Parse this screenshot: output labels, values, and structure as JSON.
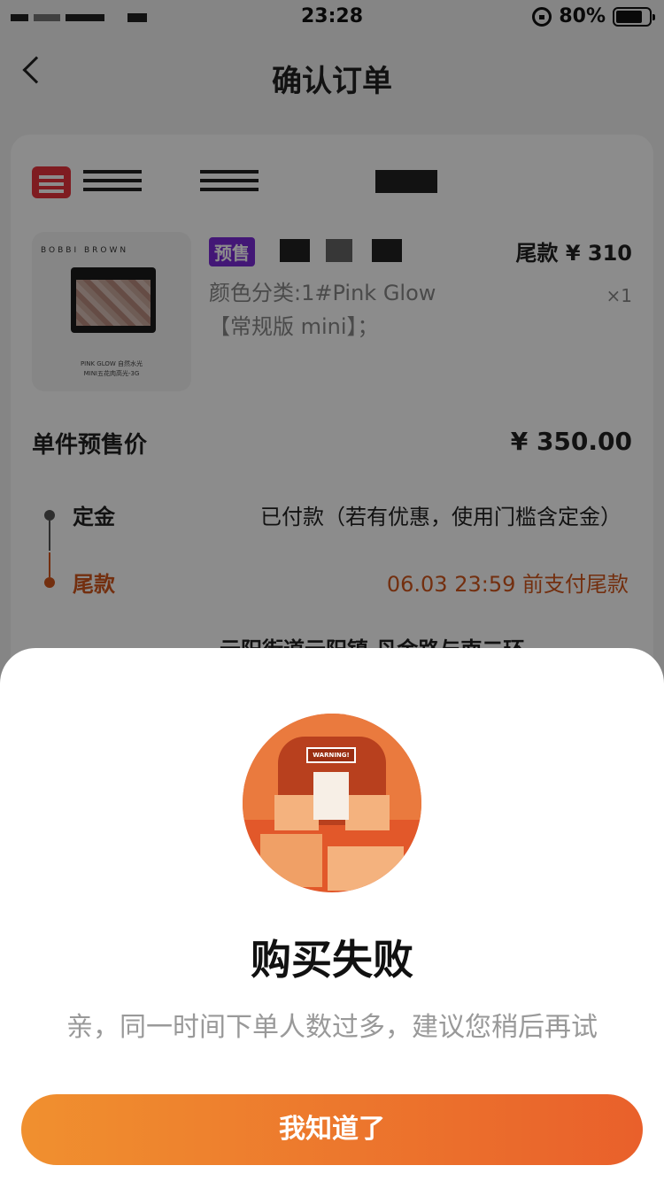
{
  "status_bar": {
    "time": "23:28",
    "battery": "80%"
  },
  "nav": {
    "title": "确认订单"
  },
  "order": {
    "product": {
      "brand": "BOBBI BROWN",
      "caption_line1": "PINK GLOW 自然水光",
      "caption_line2": "MINI五花肉高光-3G",
      "badge": "预售",
      "final_payment": "尾款 ¥ 310",
      "spec": "颜色分类:1#Pink Glow【常规版 mini】；",
      "qty": "×1"
    },
    "unit_price_label": "单件预售价",
    "unit_price_value": "¥ 350.00",
    "steps": {
      "deposit_label": "定金",
      "deposit_text": "已付款（若有优惠，使用门槛含定金）",
      "balance_label": "尾款",
      "balance_text": "06.03 23:59 前支付尾款"
    },
    "address_peek": "云阳街道云阳镇 丹金路与南二环"
  },
  "sheet": {
    "illustration_sign": "WARNING!",
    "title": "购买失败",
    "message": "亲，同一时间下单人数过多，建议您稍后再试",
    "button_label": "我知道了"
  }
}
